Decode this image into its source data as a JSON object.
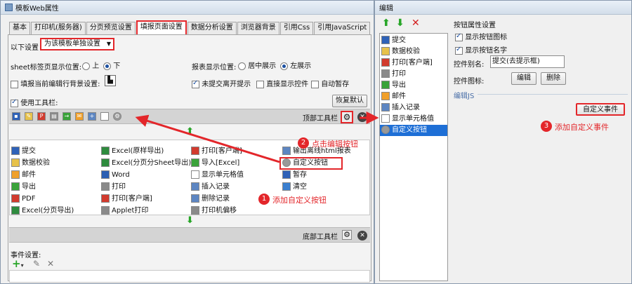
{
  "left_window": {
    "title": "模板Web属性",
    "tabs": [
      "基本",
      "打印机(服务器)",
      "分页预览设置",
      "填报页面设置",
      "数据分析设置",
      "浏览器背景",
      "引用Css",
      "引用JavaScript"
    ],
    "setting_label": "以下设置",
    "setting_value": "为该模板单独设置",
    "sheet_pos_label": "sheet标签页显示位置:",
    "sheet_up": "上",
    "sheet_down": "下",
    "report_pos_label": "报表显示位置:",
    "report_center": "居中展示",
    "report_left": "左展示",
    "fill_bg_label": "填报当前编辑行背景设置:",
    "unsubmitted_label": "未提交离开提示",
    "direct_show_label": "直接显示控件",
    "autosave_label": "自动暂存",
    "use_toolbar_label": "使用工具栏:",
    "restore_default": "恢复默认",
    "top_toolbar_label": "顶部工具栏",
    "bottom_toolbar_label": "底部工具栏",
    "event_settings_label": "事件设置:",
    "col1": [
      "提交",
      "数据校验",
      "邮件",
      "导出",
      "PDF",
      "Excel(分页导出)"
    ],
    "col2": [
      "Excel(原样导出)",
      "Excel(分页分Sheet导出)",
      "Word",
      "打印",
      "打印[客户端]",
      "Applet打印"
    ],
    "col3": [
      "打印[客户端]",
      "导入[Excel]",
      "显示单元格值",
      "插入记录",
      "删除记录",
      "打印机偏移"
    ],
    "col4": [
      "输出离线html报表",
      "自定义按钮",
      "暂存",
      "清空"
    ]
  },
  "right_window": {
    "title": "编辑",
    "list": [
      "提交",
      "数据校验",
      "打印[客户端]",
      "打印",
      "导出",
      "邮件",
      "插入记录",
      "显示单元格值",
      "自定义按钮"
    ],
    "section_title": "按钮属性设置",
    "show_icon_label": "显示按钮图标",
    "show_name_label": "显示按钮名字",
    "alias_label": "控件别名:",
    "alias_value": "提交(去提示框)",
    "icon_label": "控件图标:",
    "edit_btn": "编辑",
    "delete_btn": "删除",
    "edit_js_label": "编辑JS",
    "custom_event_btn": "自定义事件"
  },
  "annotations": {
    "n1": "1",
    "t1": "添加自定义按钮",
    "n2": "2",
    "t2": "点击编辑按钮",
    "n3": "3",
    "t3": "添加自定义事件"
  },
  "colors": {
    "accent_red": "#e3262a",
    "selection_blue": "#1e6fd6",
    "arrow_green": "#27a527"
  }
}
